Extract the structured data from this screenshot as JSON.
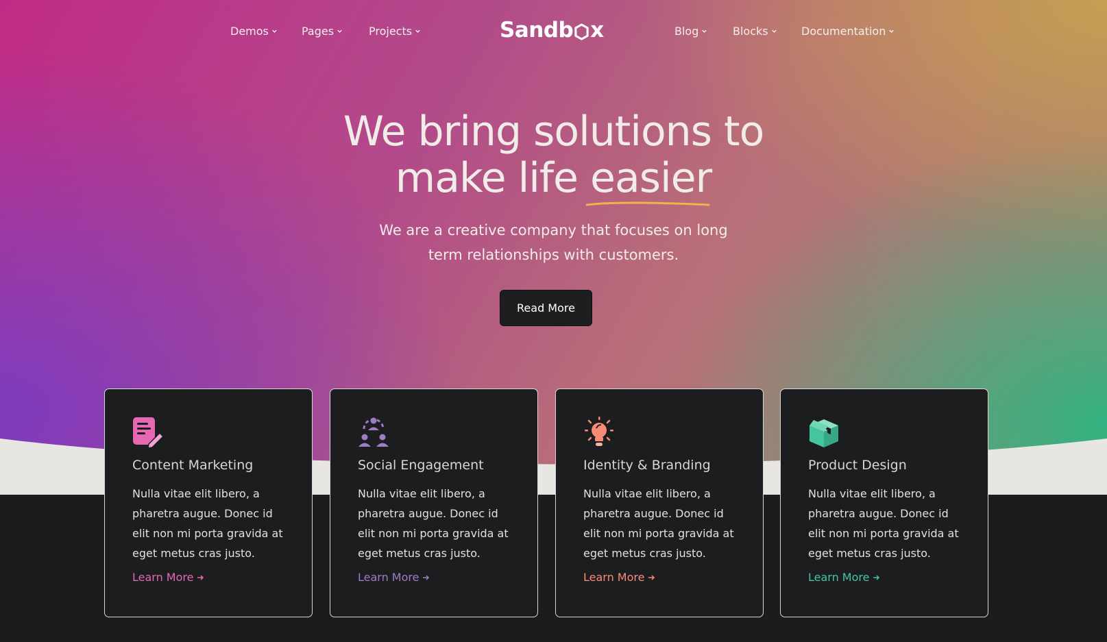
{
  "nav": {
    "left": [
      {
        "label": "Demos"
      },
      {
        "label": "Pages"
      },
      {
        "label": "Projects"
      }
    ],
    "logo": {
      "before": "Sandb",
      "after": "x"
    },
    "right": [
      {
        "label": "Blog"
      },
      {
        "label": "Blocks"
      },
      {
        "label": "Documentation"
      }
    ]
  },
  "hero": {
    "line1": "We bring solutions to",
    "line2_start": "make life ",
    "line2_highlight": "easier",
    "subtitle_line1": "We are a creative company that focuses on long",
    "subtitle_line2": "term relationships with customers.",
    "button_label": "Read More"
  },
  "colors": {
    "pink": "#e668b3",
    "purple": "#a07cc5",
    "orange": "#f78b77",
    "green": "#45c4a0",
    "underline": "#f6b04a"
  },
  "services": [
    {
      "icon": "document-edit-icon",
      "title": "Content Marketing",
      "text": "Nulla vitae elit libero, a pharetra augue. Donec id elit non mi porta gravida at eget metus cras justo.",
      "link": "Learn More",
      "color": "#e668b3"
    },
    {
      "icon": "team-icon",
      "title": "Social Engagement",
      "text": "Nulla vitae elit libero, a pharetra augue. Donec id elit non mi porta gravida at eget metus cras justo.",
      "link": "Learn More",
      "color": "#a07cc5"
    },
    {
      "icon": "lightbulb-icon",
      "title": "Identity & Branding",
      "text": "Nulla vitae elit libero, a pharetra augue. Donec id elit non mi porta gravida at eget metus cras justo.",
      "link": "Learn More",
      "color": "#f78b77"
    },
    {
      "icon": "box-icon",
      "title": "Product Design",
      "text": "Nulla vitae elit libero, a pharetra augue. Donec id elit non mi porta gravida at eget metus cras justo.",
      "link": "Learn More",
      "color": "#45c4a0"
    }
  ]
}
